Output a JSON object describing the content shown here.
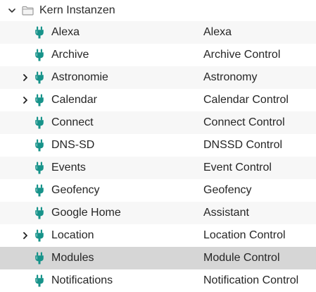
{
  "root": {
    "label": "Kern Instanzen",
    "expanded": true,
    "toggle_icon": "chevron-down-icon",
    "icon": "folder-icon"
  },
  "colors": {
    "plug_icon": "#17938a",
    "row_alt": "#f7f7f7",
    "row_selected": "#d6d6d6",
    "text": "#262626"
  },
  "rows": [
    {
      "name": "Alexa",
      "title": "Alexa",
      "expandable": false,
      "selected": false
    },
    {
      "name": "Archive",
      "title": "Archive Control",
      "expandable": false,
      "selected": false
    },
    {
      "name": "Astronomie",
      "title": "Astronomy",
      "expandable": true,
      "selected": false
    },
    {
      "name": "Calendar",
      "title": "Calendar Control",
      "expandable": true,
      "selected": false
    },
    {
      "name": "Connect",
      "title": "Connect Control",
      "expandable": false,
      "selected": false
    },
    {
      "name": "DNS-SD",
      "title": "DNSSD Control",
      "expandable": false,
      "selected": false
    },
    {
      "name": "Events",
      "title": "Event Control",
      "expandable": false,
      "selected": false
    },
    {
      "name": "Geofency",
      "title": "Geofency",
      "expandable": false,
      "selected": false
    },
    {
      "name": "Google Home",
      "title": "Assistant",
      "expandable": false,
      "selected": false
    },
    {
      "name": "Location",
      "title": "Location Control",
      "expandable": true,
      "selected": false
    },
    {
      "name": "Modules",
      "title": "Module Control",
      "expandable": false,
      "selected": true
    },
    {
      "name": "Notifications",
      "title": "Notification Control",
      "expandable": false,
      "selected": false
    }
  ]
}
